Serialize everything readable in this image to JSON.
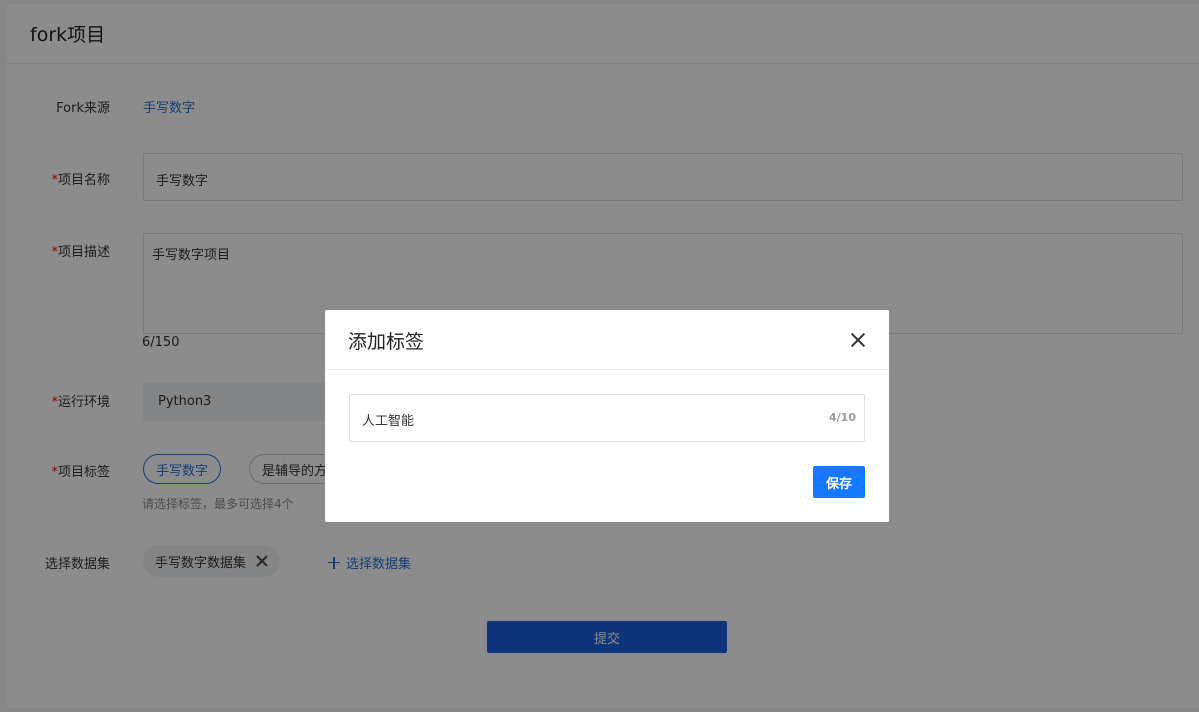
{
  "page": {
    "title": "fork项目"
  },
  "form": {
    "fork_source": {
      "label": "Fork来源",
      "value": "手写数字"
    },
    "project_name": {
      "label": "项目名称",
      "value": "手写数字"
    },
    "project_desc": {
      "label": "项目描述",
      "value": "手写数字项目",
      "counter": "6/150"
    },
    "runtime": {
      "label": "运行环境",
      "selected": "Python3"
    },
    "tags": {
      "label": "项目标签",
      "items": [
        {
          "label": "手写数字",
          "selected": true
        },
        {
          "label": "是辅导的方",
          "selected": false
        }
      ],
      "hint": "请选择标签，最多可选择4个"
    },
    "dataset": {
      "label": "选择数据集",
      "chip": "手写数字数据集",
      "add_label": "选择数据集"
    },
    "required_mark": "*",
    "submit_label": "提交"
  },
  "modal": {
    "title": "添加标签",
    "input_value": "人工智能",
    "input_counter": "4/10",
    "save_label": "保存"
  },
  "colors": {
    "primary": "#1677ff",
    "link": "#2a6fd6",
    "required": "#e02020"
  }
}
